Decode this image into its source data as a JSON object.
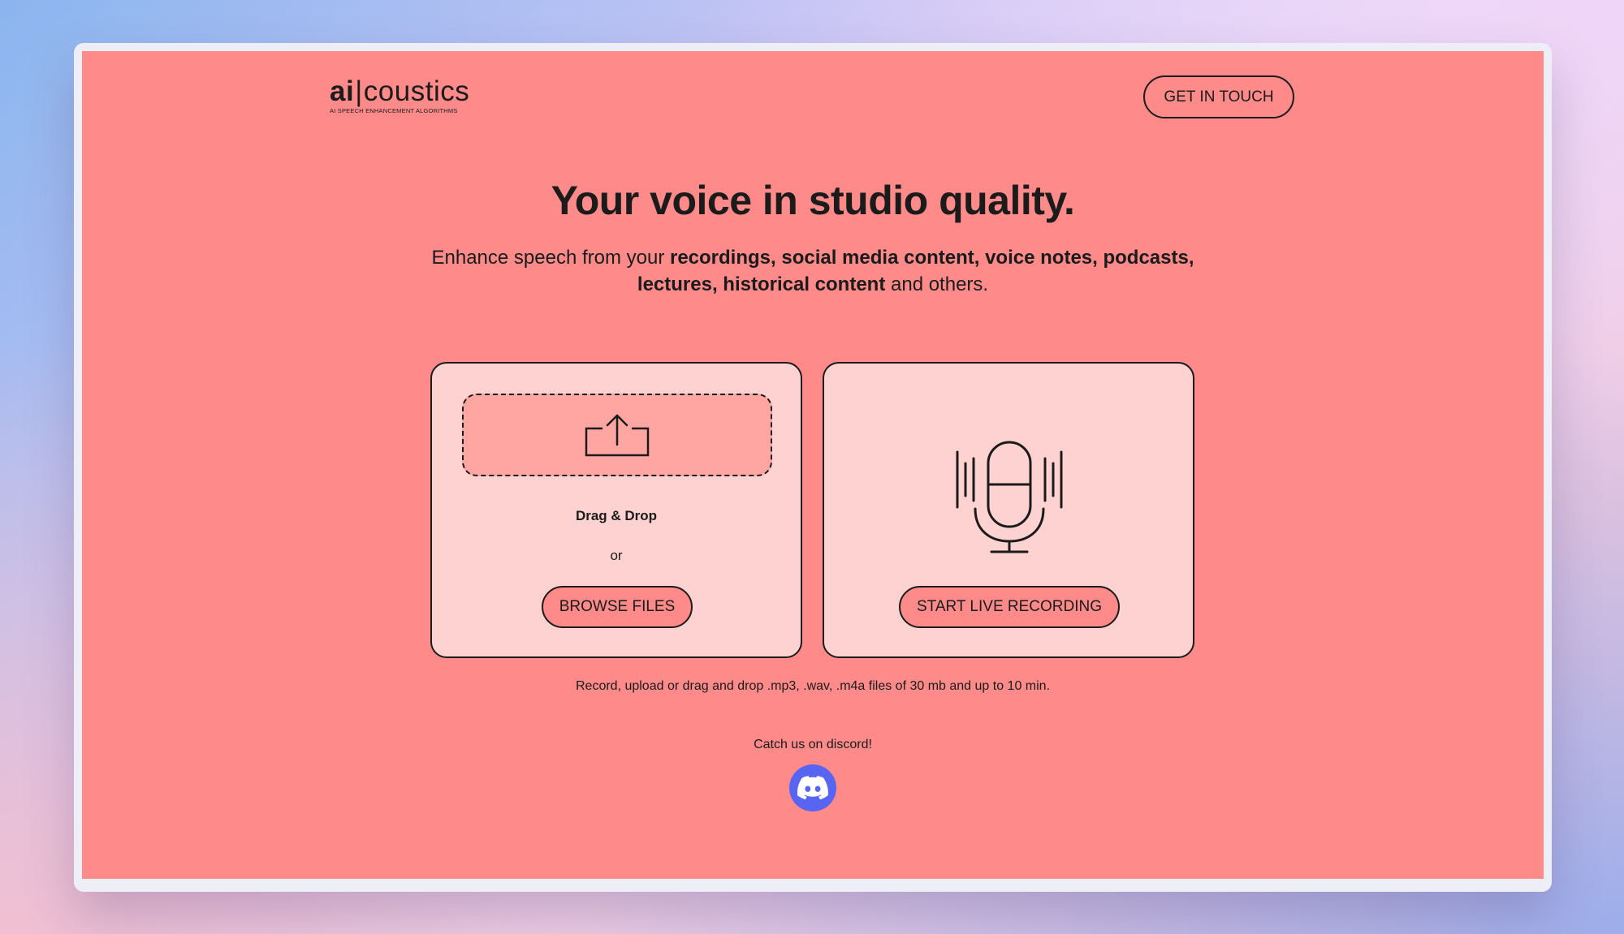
{
  "brand": {
    "logo_ai": "ai",
    "logo_bar": "|",
    "logo_rest": "coustics",
    "tagline": "AI SPEECH ENHANCEMENT ALGORITHMS"
  },
  "header": {
    "cta_label": "GET IN TOUCH"
  },
  "hero": {
    "title": "Your voice in studio quality.",
    "subtitle_start": "Enhance speech from your ",
    "subtitle_bold_1": "recordings, social media content, voice notes, podcasts,",
    "subtitle_bold_2": "lectures, historical content",
    "subtitle_end": " and others."
  },
  "upload_card": {
    "dropzone_icon": "upload-icon",
    "drag_drop_label": "Drag & Drop",
    "or_label": "or",
    "browse_label": "BROWSE FILES"
  },
  "record_card": {
    "icon": "microphone-icon",
    "record_label": "START LIVE RECORDING"
  },
  "footer": {
    "note": "Record, upload or drag and drop .mp3, .wav, .m4a files of 30 mb and up to 10 min.",
    "discord_label": "Catch us on discord!",
    "discord_icon": "discord-icon"
  },
  "colors": {
    "page_bg": "#ff8a8a",
    "card_bg": "#ffd2d2",
    "dropzone_bg": "#ffa6a2",
    "text": "#1b1b1b",
    "discord": "#5865f2"
  }
}
